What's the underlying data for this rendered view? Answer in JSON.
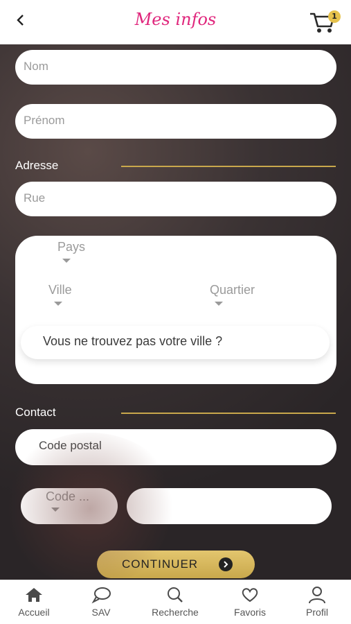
{
  "header": {
    "title": "Mes infos",
    "cart_count": "1",
    "accent_color": "#e0267c"
  },
  "form": {
    "nom_placeholder": "Nom",
    "prenom_placeholder": "Prénom",
    "adresse_label": "Adresse",
    "rue_placeholder": "Rue",
    "pays_label": "Pays",
    "ville_label": "Ville",
    "quartier_label": "Quartier",
    "city_not_found": "Vous ne trouvez pas votre ville ?",
    "contact_label": "Contact",
    "code_postal_placeholder": "Code postal",
    "code_label": "Code ...",
    "phone_value": ""
  },
  "actions": {
    "continue_label": "CONTINUER"
  },
  "tabs": [
    {
      "label": "Accueil",
      "icon": "home-icon"
    },
    {
      "label": "SAV",
      "icon": "chat-icon"
    },
    {
      "label": "Recherche",
      "icon": "search-icon"
    },
    {
      "label": "Favoris",
      "icon": "heart-icon"
    },
    {
      "label": "Profil",
      "icon": "user-icon"
    }
  ],
  "colors": {
    "gold": "#c9a84c",
    "background": "#2d2829"
  }
}
